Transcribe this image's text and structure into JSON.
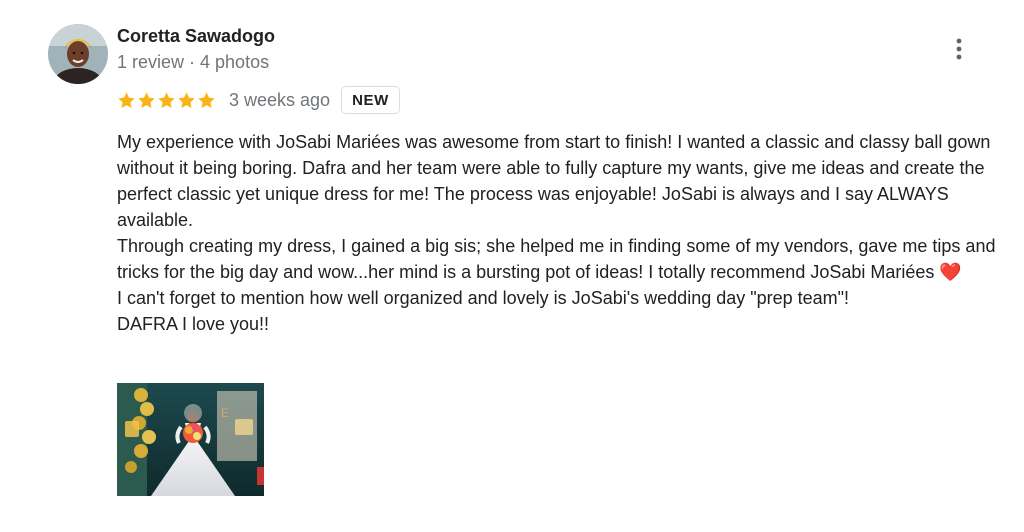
{
  "reviewer": {
    "name": "Coretta Sawadogo",
    "meta": "1 review · 4 photos"
  },
  "review": {
    "rating": 5,
    "time_ago": "3 weeks ago",
    "badge": "NEW",
    "paragraphs": [
      "My experience with JoSabi Mariées was awesome from start to finish! I wanted a classic and classy ball gown without it being boring. Dafra and her team were able to fully capture my wants, give me ideas and create the perfect classic yet unique dress for me! The process was enjoyable! JoSabi is always and I say ALWAYS available.",
      "Through creating my dress, I gained a big sis; she helped me in finding some of my vendors, gave me tips and tricks for the big day and wow...her mind is a bursting pot of ideas! I totally recommend JoSabi Mariées",
      "I can't forget to mention how well organized and lovely is JoSabi's wedding day \"prep team\"!",
      "DAFRA I love you!!"
    ],
    "heart_emoji": "❤️"
  },
  "icons": {
    "star": "star-icon",
    "more": "more-vert-icon",
    "heart": "heart-emoji"
  },
  "colors": {
    "star": "#f9b515",
    "meta_text": "#70757a",
    "primary_text": "#202124",
    "badge_border": "#dadce0"
  }
}
